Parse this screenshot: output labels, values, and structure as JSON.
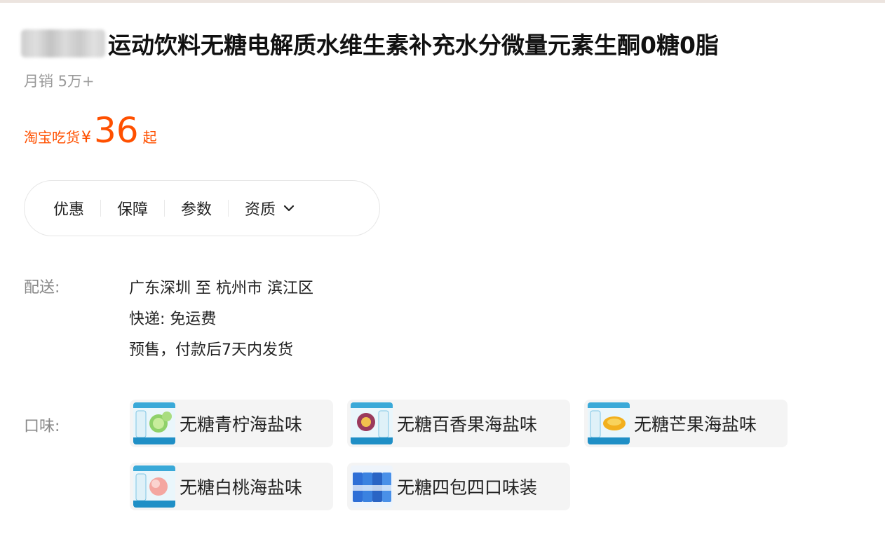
{
  "product": {
    "title": "运动饮料无糖电解质水维生素补充水分微量元素生酮0糖0脂",
    "sales": "月销 5万+"
  },
  "price": {
    "prefix": "淘宝吃货",
    "currency": "¥",
    "value": "36",
    "suffix": "起",
    "color": "#ff5000"
  },
  "tabs": [
    {
      "label": "优惠"
    },
    {
      "label": "保障"
    },
    {
      "label": "参数"
    },
    {
      "label": "资质",
      "icon": "chevron-down-icon"
    }
  ],
  "delivery": {
    "label": "配送:",
    "route": "广东深圳 至 杭州市 滨江区",
    "shipping": "快递: 免运费",
    "presale": "预售，付款后7天内发货"
  },
  "flavor": {
    "label": "口味:",
    "options": [
      {
        "label": "无糖青柠海盐味",
        "fruit": "lime",
        "fruit_color": "#8fd16a"
      },
      {
        "label": "无糖百香果海盐味",
        "fruit": "passion-fruit",
        "fruit_color": "#9b3a5c"
      },
      {
        "label": "无糖芒果海盐味",
        "fruit": "mango",
        "fruit_color": "#f2b01e"
      },
      {
        "label": "无糖白桃海盐味",
        "fruit": "peach",
        "fruit_color": "#f4a6a0"
      },
      {
        "label": "无糖四包四口味装",
        "fruit": "multi-pack",
        "fruit_color": "#2f6fd6"
      }
    ]
  }
}
